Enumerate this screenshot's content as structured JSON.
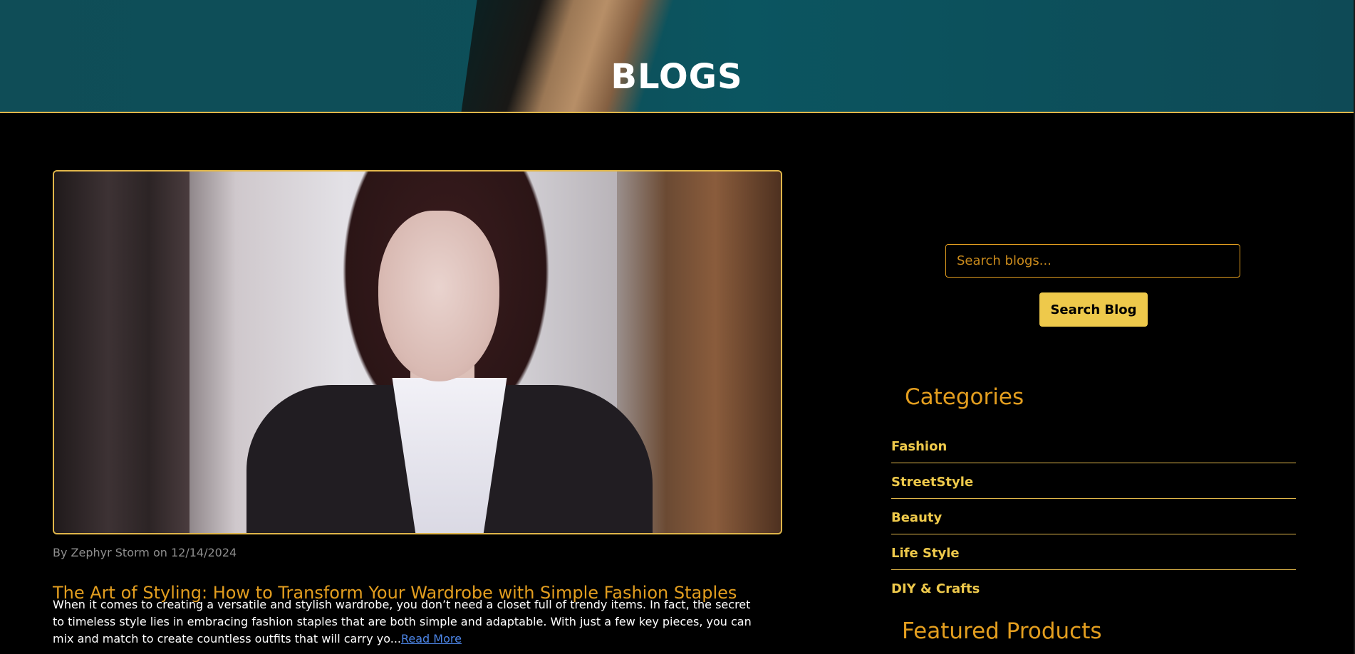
{
  "hero": {
    "title": "BLOGS"
  },
  "post": {
    "meta": "By Zephyr Storm on 12/14/2024",
    "title": "The Art of Styling: How to Transform Your Wardrobe with Simple Fashion Staples",
    "excerpt": "When it comes to creating a versatile and stylish wardrobe, you don’t need a closet full of trendy items. In fact, the secret to timeless style lies in embracing fashion staples that are both simple and adaptable. With just a few key pieces, you can mix and match to create countless outfits that will carry yo...",
    "read_more": "Read More"
  },
  "sidebar": {
    "search": {
      "placeholder": "Search blogs...",
      "button_label": "Search Blog"
    },
    "categories": {
      "heading": "Categories",
      "items": [
        "Fashion",
        "StreetStyle",
        "Beauty",
        "Life Style",
        "DIY & Crafts"
      ]
    },
    "featured_heading": "Featured Products"
  },
  "colors": {
    "accent": "#e39e1f",
    "button": "#eec94b",
    "link": "#4d86e8",
    "hero": "#0d4f59"
  }
}
